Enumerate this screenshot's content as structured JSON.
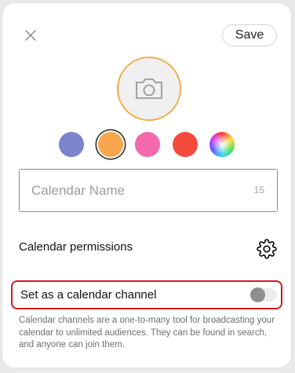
{
  "header": {
    "save_label": "Save"
  },
  "photo": {
    "icon": "camera-icon",
    "ring_color": "#f2ad4c"
  },
  "colors": [
    {
      "name": "periwinkle",
      "hex": "#7b83cb",
      "selected": false
    },
    {
      "name": "orange",
      "hex": "#f9a64e",
      "selected": true
    },
    {
      "name": "pink",
      "hex": "#f46aaa",
      "selected": false
    },
    {
      "name": "red",
      "hex": "#f44b3c",
      "selected": false
    },
    {
      "name": "rainbow",
      "hex": "conic",
      "selected": false
    }
  ],
  "name_field": {
    "placeholder": "Calendar Name",
    "value": "",
    "char_count": "15"
  },
  "permissions": {
    "label": "Calendar permissions",
    "icon": "gear-icon"
  },
  "channel": {
    "label": "Set as a calendar channel",
    "enabled": false,
    "highlight_color": "#d0191f",
    "description": "Calendar channels are a one-to-many tool for broadcasting your calendar to unlimited audiences. They can be found in search, and anyone can join them."
  }
}
